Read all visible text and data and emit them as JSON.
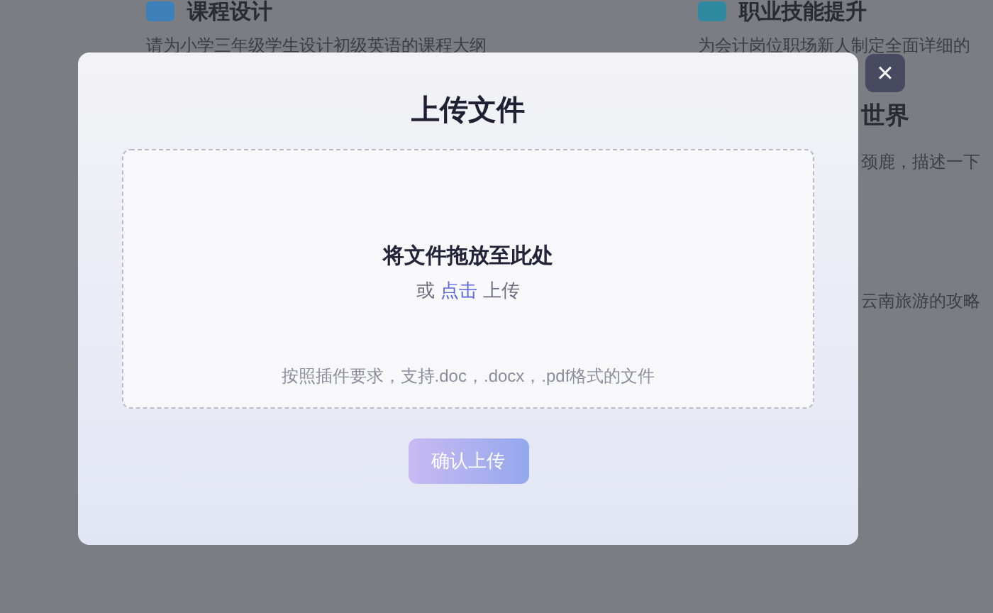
{
  "background_cards": [
    {
      "title": "课程设计",
      "description": "请为小学三年级学生设计初级英语的课程大纲"
    },
    {
      "title": "职业技能提升",
      "description": "为会计岗位职场新人制定全面详细的"
    }
  ],
  "background_fragments": [
    {
      "kind": "title",
      "text": "世界"
    },
    {
      "kind": "line",
      "text": "颈鹿，描述一下"
    },
    {
      "kind": "line",
      "text": "云南旅游的攻略"
    }
  ],
  "dialog": {
    "title": "上传文件",
    "close": "×",
    "dropzone": {
      "heading": "将文件拖放至此处",
      "prompt_before": "或",
      "link": "点击",
      "prompt_after": "上传",
      "hint": "按照插件要求，支持.doc，.docx，.pdf格式的文件"
    },
    "confirm_button": {
      "label": "确认上传",
      "disabled": true
    }
  }
}
